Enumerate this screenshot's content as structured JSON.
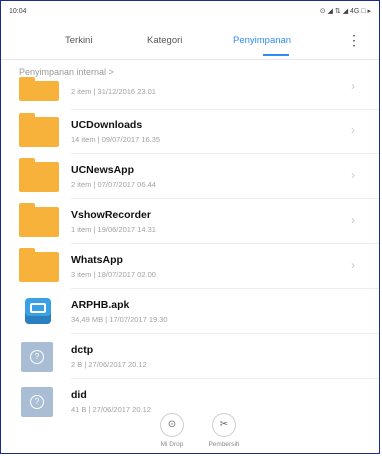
{
  "status_bar": {
    "time": "10:04",
    "indicators": "⊙ ◢ ⇅ ◢ 4G □ ▸"
  },
  "tabs": [
    {
      "label": "Terkini",
      "active": false
    },
    {
      "label": "Kategori",
      "active": false
    },
    {
      "label": "Penyimpanan",
      "active": true
    }
  ],
  "menu_icon": "more-vert-icon",
  "breadcrumb": "Penyimpanan internal >",
  "items": [
    {
      "type": "folder",
      "name": "",
      "meta": "2 item | 31/12/2016 23.01",
      "chevron": true
    },
    {
      "type": "folder",
      "name": "UCDownloads",
      "meta": "14 item | 09/07/2017 16.35",
      "chevron": true
    },
    {
      "type": "folder",
      "name": "UCNewsApp",
      "meta": "2 item | 07/07/2017 06.44",
      "chevron": true
    },
    {
      "type": "folder",
      "name": "VshowRecorder",
      "meta": "1 item | 19/06/2017 14.31",
      "chevron": true
    },
    {
      "type": "folder",
      "name": "WhatsApp",
      "meta": "3 item | 18/07/2017 02.00",
      "chevron": true
    },
    {
      "type": "apk",
      "name": "ARPHB.apk",
      "meta": "34,49 MB | 17/07/2017 19.30",
      "chevron": false
    },
    {
      "type": "unknown",
      "name": "dctp",
      "meta": "2 B | 27/06/2017 20.12",
      "chevron": false
    },
    {
      "type": "unknown",
      "name": "did",
      "meta": "41 B | 27/06/2017 20.12",
      "chevron": false
    }
  ],
  "bottom": [
    {
      "label": "Mi Drop",
      "icon": "mi-drop-icon"
    },
    {
      "label": "Pembersih",
      "icon": "cleaner-icon"
    }
  ],
  "colors": {
    "accent": "#2f8cf7",
    "folder": "#f7b23b"
  }
}
